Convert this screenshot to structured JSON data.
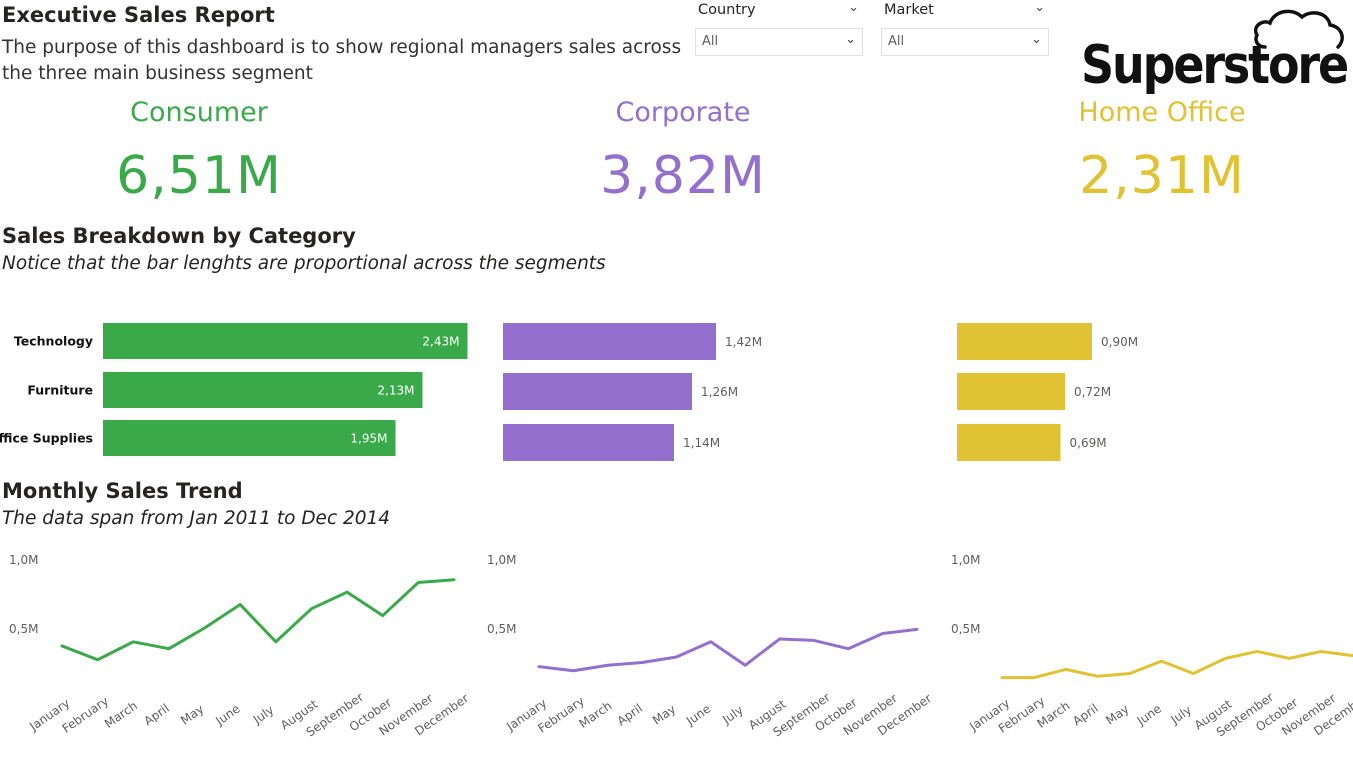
{
  "header": {
    "title": "Executive Sales Report",
    "subtitle": "The purpose of this dashboard is to show regional managers sales across the three main business segment"
  },
  "filters": [
    {
      "label": "Country",
      "value": "All"
    },
    {
      "label": "Market",
      "value": "All"
    }
  ],
  "logo": {
    "text": "Superstore"
  },
  "kpis": [
    {
      "label": "Consumer",
      "value": "6,51M",
      "color": "#3aa94a"
    },
    {
      "label": "Corporate",
      "value": "3,82M",
      "color": "#9370cd"
    },
    {
      "label": "Home Office",
      "value": "2,31M",
      "color": "#e0c232"
    }
  ],
  "sections": {
    "breakdown_title": "Sales Breakdown by Category",
    "breakdown_sub": "Notice that the bar lenghts are proportional across the segments",
    "trend_title": "Monthly Sales Trend",
    "trend_sub": "The data span from Jan 2011 to Dec 2014"
  },
  "chart_data": [
    {
      "type": "bar",
      "orientation": "horizontal",
      "categories": [
        "Technology",
        "Furniture",
        "Office Supplies"
      ],
      "values": [
        2.43,
        2.13,
        1.95
      ],
      "labels": [
        "2,43M",
        "2,13M",
        "1,95M"
      ],
      "color": "#3aa94a"
    },
    {
      "type": "bar",
      "orientation": "horizontal",
      "categories": [
        "Technology",
        "Furniture",
        "Office Supplies"
      ],
      "values": [
        1.42,
        1.26,
        1.14
      ],
      "labels": [
        "1,42M",
        "1,26M",
        "1,14M"
      ],
      "color": "#9370cd"
    },
    {
      "type": "bar",
      "orientation": "horizontal",
      "categories": [
        "Technology",
        "Furniture",
        "Office Supplies"
      ],
      "values": [
        0.9,
        0.72,
        0.69
      ],
      "labels": [
        "0,90M",
        "0,72M",
        "0,69M"
      ],
      "color": "#e0c232"
    },
    {
      "type": "line",
      "x": [
        "January",
        "February",
        "March",
        "April",
        "May",
        "June",
        "July",
        "August",
        "September",
        "October",
        "November",
        "December"
      ],
      "values": [
        0.37,
        0.27,
        0.4,
        0.35,
        0.5,
        0.67,
        0.4,
        0.64,
        0.76,
        0.59,
        0.83,
        0.85
      ],
      "ylim": [
        0,
        1.0
      ],
      "yticks": [
        {
          "v": 1.0,
          "label": "1,0M"
        },
        {
          "v": 0.5,
          "label": "0,5M"
        }
      ],
      "color": "#3aa94a"
    },
    {
      "type": "line",
      "x": [
        "January",
        "February",
        "March",
        "April",
        "May",
        "June",
        "July",
        "August",
        "September",
        "October",
        "November",
        "December"
      ],
      "values": [
        0.22,
        0.19,
        0.23,
        0.25,
        0.29,
        0.4,
        0.23,
        0.42,
        0.41,
        0.35,
        0.46,
        0.49
      ],
      "ylim": [
        0,
        1.0
      ],
      "yticks": [
        {
          "v": 1.0,
          "label": "1,0M"
        },
        {
          "v": 0.5,
          "label": "0,5M"
        }
      ],
      "color": "#9370cd"
    },
    {
      "type": "line",
      "x": [
        "January",
        "February",
        "March",
        "April",
        "May",
        "June",
        "July",
        "August",
        "September",
        "October",
        "November",
        "December"
      ],
      "values": [
        0.14,
        0.14,
        0.2,
        0.15,
        0.17,
        0.26,
        0.17,
        0.28,
        0.33,
        0.28,
        0.33,
        0.3
      ],
      "ylim": [
        0,
        1.0
      ],
      "yticks": [
        {
          "v": 1.0,
          "label": "1,0M"
        },
        {
          "v": 0.5,
          "label": "0,5M"
        }
      ],
      "color": "#e0c232"
    }
  ]
}
